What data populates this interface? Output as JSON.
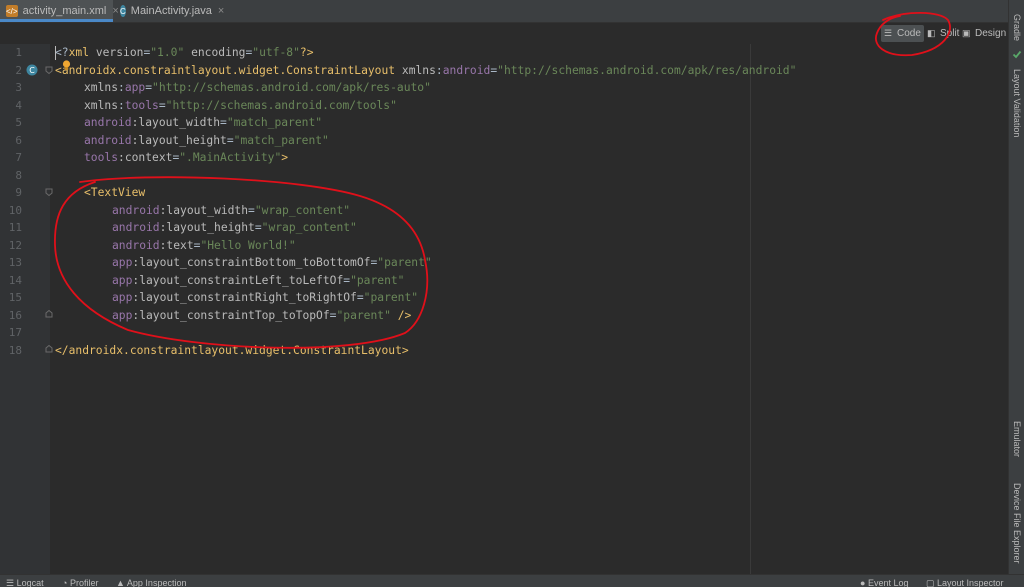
{
  "tabs": [
    {
      "label": "activity_main.xml",
      "active": true,
      "icon": "xml-file-icon"
    },
    {
      "label": "MainActivity.java",
      "active": false,
      "icon": "java-class-icon"
    }
  ],
  "view_modes": {
    "code": "Code",
    "split": "Split",
    "design": "Design"
  },
  "right_panel": {
    "gradle": "Gradle",
    "layout_validation": "Layout Validation",
    "emulator": "Emulator",
    "device_file_explorer": "Device File Explorer"
  },
  "status_bar": {
    "logcat": "Logcat",
    "profiler": "Profiler",
    "app_inspection": "App Inspection",
    "event_log": "Event Log",
    "layout_inspector": "Layout Inspector"
  },
  "line_numbers": [
    "1",
    "2",
    "3",
    "4",
    "5",
    "6",
    "7",
    "8",
    "9",
    "10",
    "11",
    "12",
    "13",
    "14",
    "15",
    "16",
    "17",
    "18"
  ],
  "code": {
    "l1": {
      "a": "<?",
      "b": "xml ",
      "c": "version",
      "d": "=",
      "e": "\"1.0\"",
      "f": " encoding",
      "g": "=",
      "h": "\"utf-8\"",
      "i": "?>"
    },
    "l2": {
      "a": "<",
      "b": "androidx.constraintlayout.widget.ConstraintLayout ",
      "c": "xmlns",
      "d": ":",
      "e": "android",
      "f": "=",
      "g": "\"http://schemas.android.com/apk/res/android\""
    },
    "l3": {
      "a": "xmlns",
      "b": ":",
      "c": "app",
      "d": "=",
      "e": "\"http://schemas.android.com/apk/res-auto\""
    },
    "l4": {
      "a": "xmlns",
      "b": ":",
      "c": "tools",
      "d": "=",
      "e": "\"http://schemas.android.com/tools\""
    },
    "l5": {
      "a": "android",
      "b": ":layout_width",
      "c": "=",
      "d": "\"match_parent\""
    },
    "l6": {
      "a": "android",
      "b": ":layout_height",
      "c": "=",
      "d": "\"match_parent\""
    },
    "l7": {
      "a": "tools",
      "b": ":context",
      "c": "=",
      "d": "\".MainActivity\"",
      "e": ">"
    },
    "l9": {
      "a": "<TextView"
    },
    "l10": {
      "a": "android",
      "b": ":layout_width",
      "c": "=",
      "d": "\"wrap_content\""
    },
    "l11": {
      "a": "android",
      "b": ":layout_height",
      "c": "=",
      "d": "\"wrap_content\""
    },
    "l12": {
      "a": "android",
      "b": ":text",
      "c": "=",
      "d": "\"Hello World!\""
    },
    "l13": {
      "a": "app",
      "b": ":layout_constraintBottom_toBottomOf",
      "c": "=",
      "d": "\"parent\""
    },
    "l14": {
      "a": "app",
      "b": ":layout_constraintLeft_toLeftOf",
      "c": "=",
      "d": "\"parent\""
    },
    "l15": {
      "a": "app",
      "b": ":layout_constraintRight_toRightOf",
      "c": "=",
      "d": "\"parent\""
    },
    "l16": {
      "a": "app",
      "b": ":layout_constraintTop_toTopOf",
      "c": "=",
      "d": "\"parent\"",
      "e": " />"
    },
    "l18": {
      "a": "</androidx.constraintlayout.widget.ConstraintLayout>"
    }
  },
  "colors": {
    "tag": "#e8bf6a",
    "namespace": "#9876aa",
    "string": "#6a8759",
    "annotation": "#e0101a"
  }
}
